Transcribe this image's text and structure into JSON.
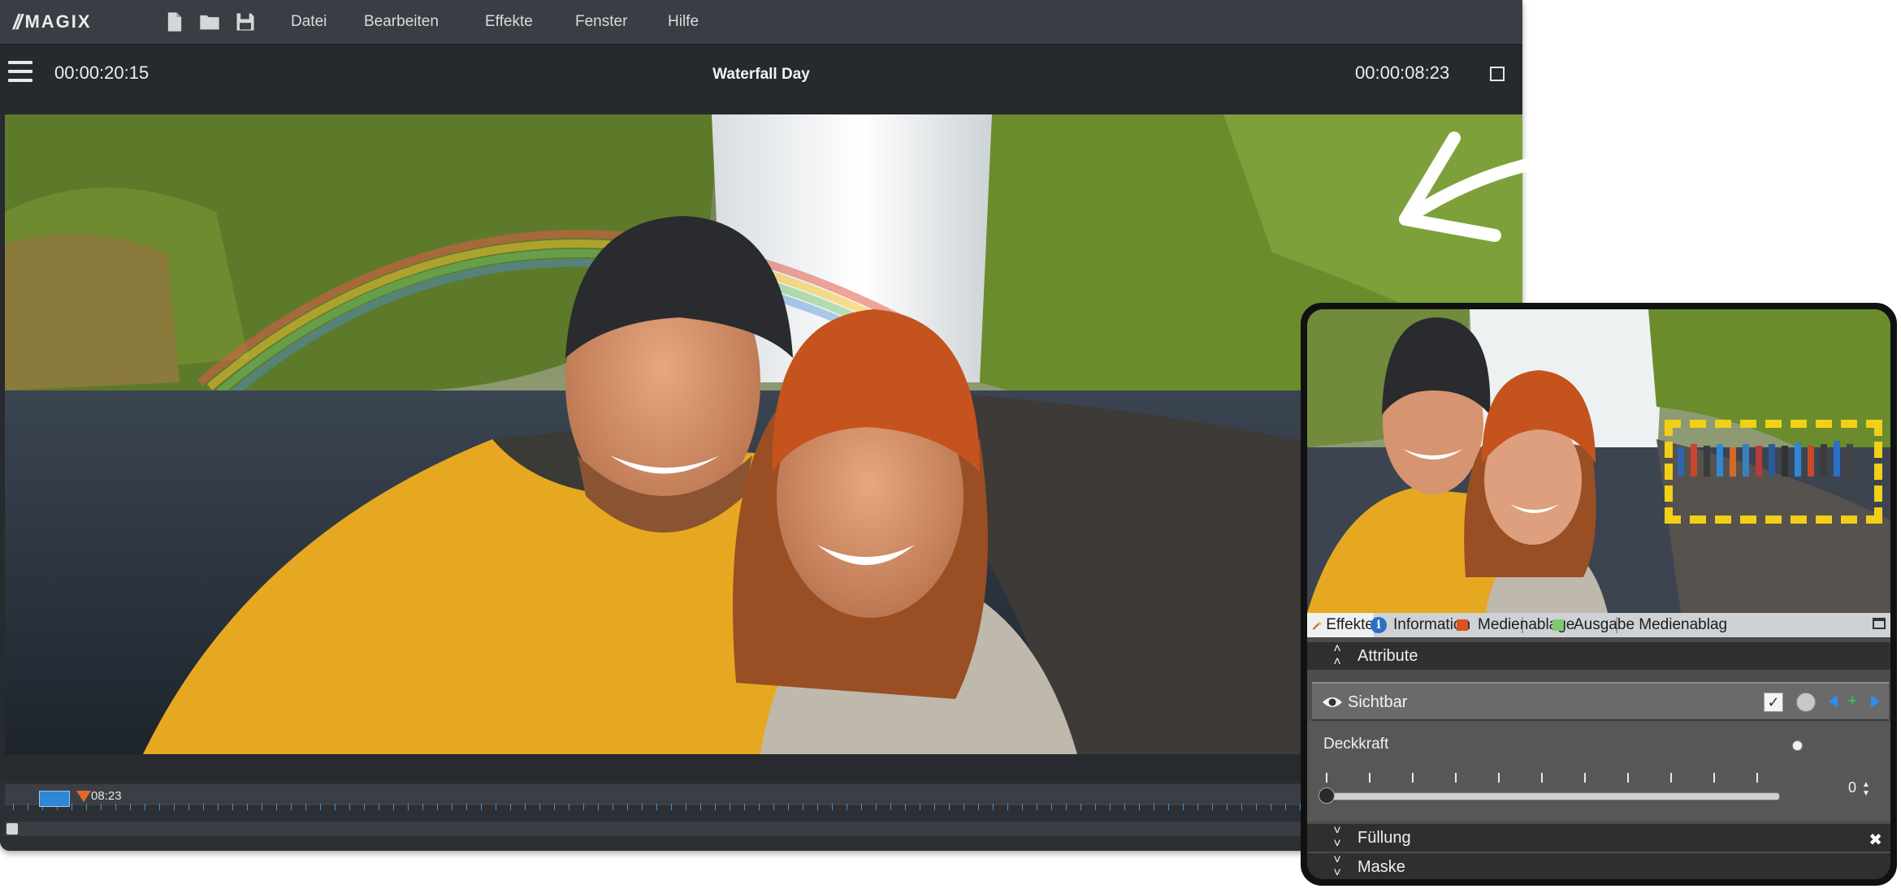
{
  "app": {
    "logo": "MAGIX",
    "logo_slashes": "//"
  },
  "menu": [
    "Datei",
    "Bearbeiten",
    "Effekte",
    "Fenster",
    "Hilfe"
  ],
  "transport": {
    "timecode_left": "00:00:20:15",
    "project_title": "Waterfall Day",
    "timecode_right": "00:00:08:23"
  },
  "timeline": {
    "playhead_label": "08:23"
  },
  "panel": {
    "tabs": [
      {
        "label": "Effekte",
        "icon": "effects-wand-icon"
      },
      {
        "label": "Information",
        "icon": "info-icon",
        "glyph": "i"
      },
      {
        "label": "Medienablage",
        "icon": "media-pool-icon",
        "color": "#d9541e"
      },
      {
        "label": "Ausgabe Medienablag",
        "icon": "output-media-icon",
        "color": "#7ec870"
      }
    ],
    "attribute_label": "Attribute",
    "sichtbar_label": "Sichtbar",
    "sichtbar_checked": true,
    "deckkraft_label": "Deckkraft",
    "deckkraft_value": "0",
    "fuellung_label": "Füllung",
    "maske_label": "Maske"
  },
  "colors": {
    "accent_blue": "#2e88d4",
    "playhead": "#e06a22",
    "highlight": "#f2cf18"
  }
}
